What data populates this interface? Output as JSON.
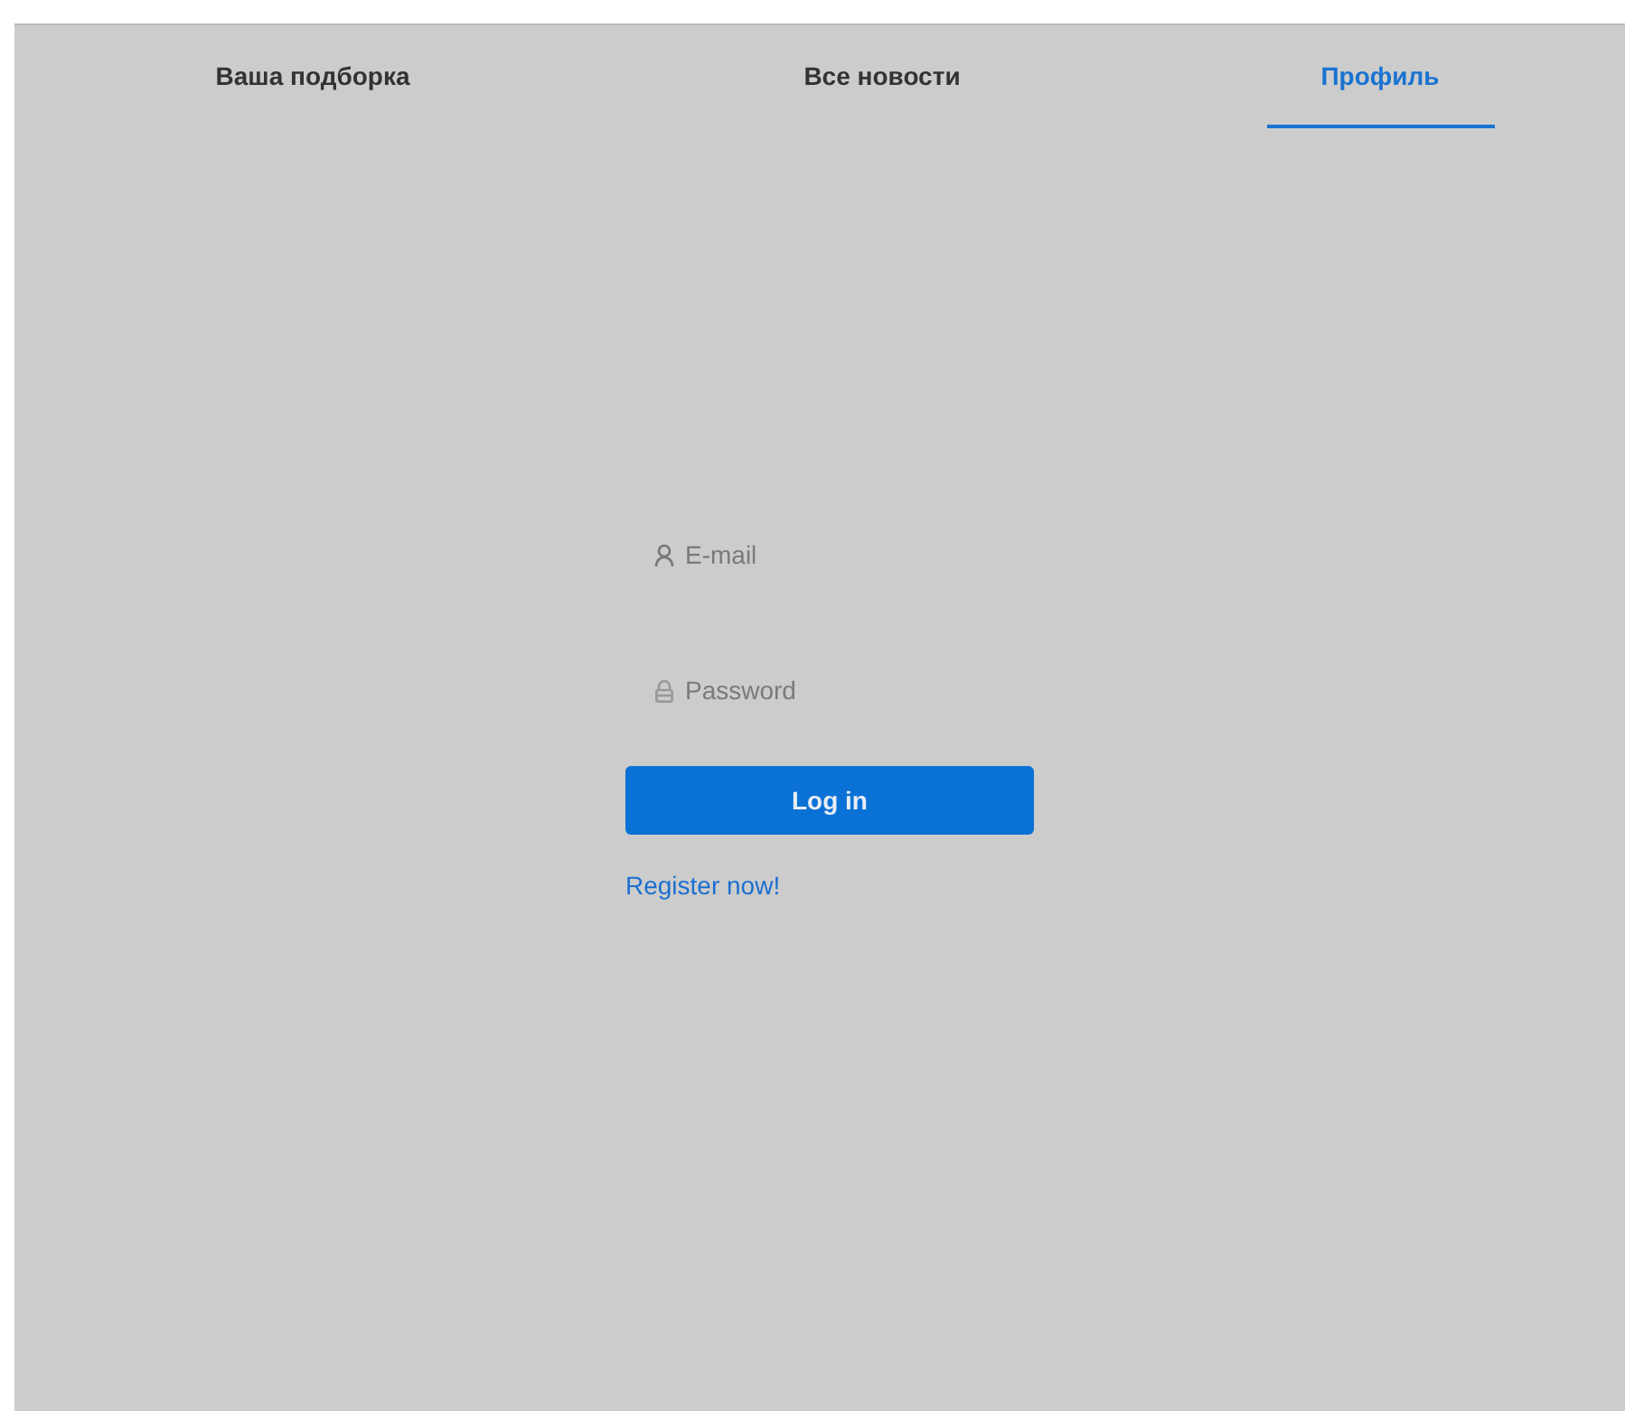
{
  "tabs": [
    {
      "label": "Ваша подборка",
      "selected": false
    },
    {
      "label": "Все новости",
      "selected": false
    },
    {
      "label": "Профиль",
      "selected": true
    }
  ],
  "login_form": {
    "fields": [
      {
        "kind": "user",
        "placeholder": "E-mail"
      },
      {
        "kind": "lock",
        "placeholder": "Password"
      }
    ],
    "submit_button": "Log in",
    "register_link": "Register now!"
  }
}
